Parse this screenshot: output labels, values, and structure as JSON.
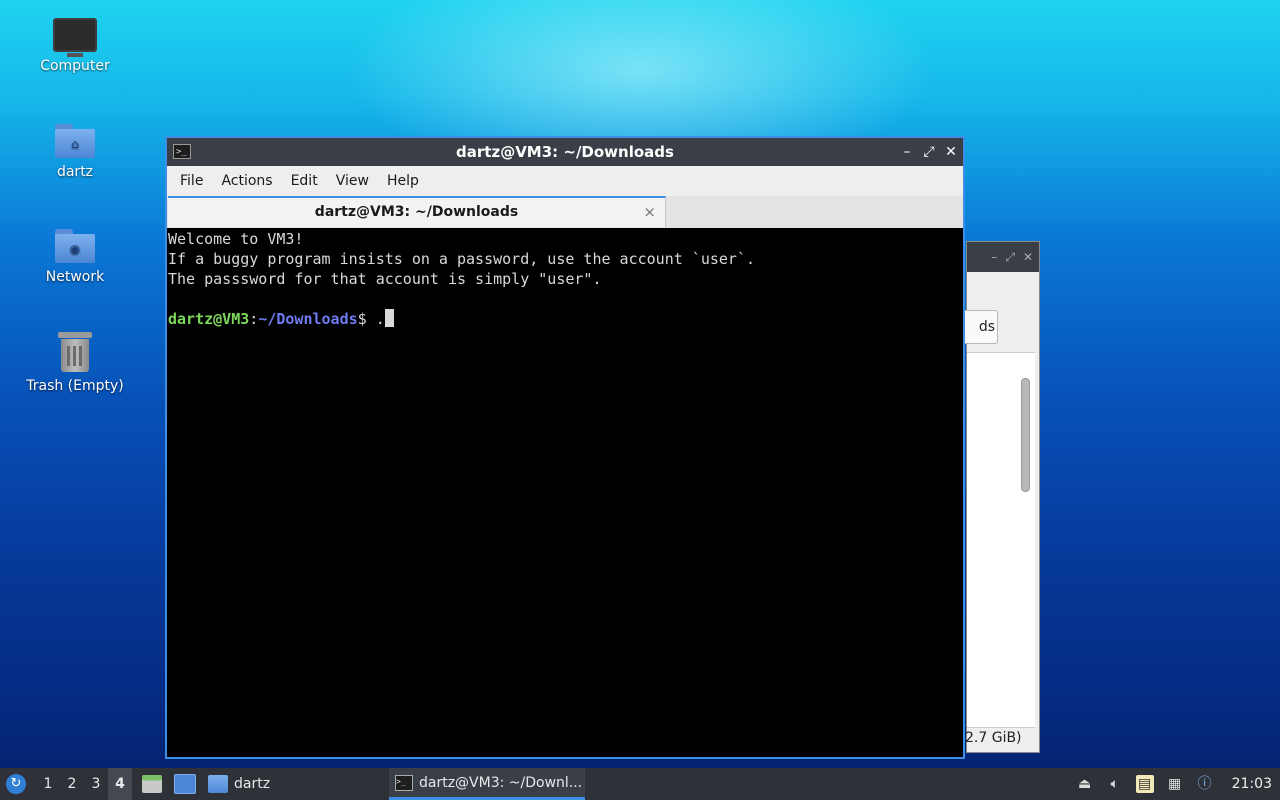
{
  "desktop": {
    "icons": [
      {
        "label": "Computer"
      },
      {
        "label": "dartz"
      },
      {
        "label": "Network"
      },
      {
        "label": "Trash (Empty)"
      }
    ]
  },
  "background_window": {
    "crumb_fragment": "ds",
    "status_fragment": "2.7 GiB)"
  },
  "terminal": {
    "window_title": "dartz@VM3: ~/Downloads",
    "controls": {
      "minimize": "–",
      "maximize": "⤢",
      "close": "✕"
    },
    "menu": [
      "File",
      "Actions",
      "Edit",
      "View",
      "Help"
    ],
    "tab": {
      "label": "dartz@VM3: ~/Downloads",
      "close": "×"
    },
    "lines": [
      "Welcome to VM3!",
      "If a buggy program insists on a password, use the account `user`.",
      "The passsword for that account is simply \"user\"."
    ],
    "prompt": {
      "user_host": "dartz@VM3",
      "colon": ":",
      "path": "~/Downloads",
      "symbol": "$ ",
      "input": "."
    }
  },
  "taskbar": {
    "workspaces": [
      "1",
      "2",
      "3",
      "4"
    ],
    "active_workspace": "4",
    "folder_item": "dartz",
    "terminal_item": "dartz@VM3: ~/Downl...",
    "clock": "21:03",
    "colors": {
      "accent": "#3d8ee6",
      "panel": "#2e3238"
    }
  }
}
